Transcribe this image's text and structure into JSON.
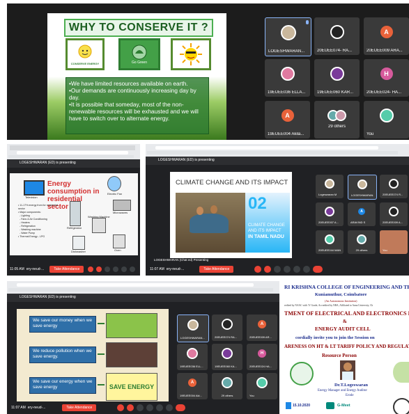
{
  "p1": {
    "slide_title": "WHY TO CONSERVE IT ?",
    "img1_caption": "CONSERVE ENERGY",
    "img2_caption": "Go Green",
    "bullets": [
      "We have limited resources available on earth.",
      "Our demands are continuously increasing day by day.",
      "It is possible that someday, most of the non-renewable resources will be exhausted and we will have to switch over to alternate energy."
    ],
    "participants": [
      {
        "name": "LOGESHWARAN...",
        "type": "photo"
      },
      {
        "name": "20EUEE074- RA...",
        "type": "photo"
      },
      {
        "name": "20EUEE009 ARA...",
        "type": "letter",
        "letter": "A"
      },
      {
        "name": "19EUEE036 ELLA...",
        "type": "photo"
      },
      {
        "name": "19EUEE060 KAR...",
        "type": "photo"
      },
      {
        "name": "20EUEE024- HA...",
        "type": "letter",
        "letter": "H"
      },
      {
        "name": "19EUEE004 Akila...",
        "type": "letter",
        "letter": "A"
      },
      {
        "name": "29 others",
        "type": "group"
      },
      {
        "name": "You",
        "type": "photo"
      }
    ]
  },
  "p2": {
    "presenting": "LOGESHWARAN (ED) is presenting",
    "slide_title": "Energy consumption in residential sector",
    "items": [
      "Television",
      "Electric Fan",
      "Refrigerator",
      "Microwaves",
      "Washing Machine",
      "Dishwasher",
      "Oven",
      "Iron"
    ],
    "bullets": [
      "11-17% energy from for residential sector",
      "Major components:",
      "Lighting",
      "Fans & Air Conditioning",
      "Heaters",
      "Refrigeration",
      "Washing machine",
      "Water Pump",
      "Thermal Energy - LPG"
    ],
    "time": "11:05 AM",
    "meeting": "ery-neud-...",
    "take_attendance": "Take Attendance"
  },
  "p3": {
    "presenting": "LOGESHWARAN (ED) is presenting",
    "slide_title": "CLIMATE CHANGE AND ITS IMPACT",
    "img_caption_line1": "CLIMATE CHANGE",
    "img_caption_line2": "AND ITS IMPACT",
    "img_caption_line3": "IN TAMIL NADU",
    "num": "02",
    "time": "11:07 AM",
    "meeting": "ery-neud-...",
    "take_attendance": "Take Attendance",
    "bottom_name": "LOGESHWARAN (Chat ed) Presenting",
    "participants": [
      "Logeswaran M",
      "LOGESHWARAN...",
      "20EUEE074 R...",
      "20EUEE007 A...",
      "ARAVIND S",
      "20EUEE009 A...",
      "20EUEE044 MAN...",
      "29 others",
      "You"
    ]
  },
  "p4": {
    "presenting": "LOGESHWARAN (ED) is presenting",
    "boxes": [
      "We save our money when we save energy",
      "We reduce pollution when we save energy.",
      "We save our energy when we save energy"
    ],
    "img3_text": "SAVE ENERGY",
    "time": "11:07 AM",
    "meeting": "ery-neud-...",
    "take_attendance": "Take Attendance",
    "participants": [
      "LOGESHWARAN...",
      "20EUEE074 RA...",
      "20EUEE009 AR...",
      "19EUEE036 ELL...",
      "19EUEE060 KA...",
      "20EUEE024 HA...",
      "19EUEE004 Aki...",
      "29 others",
      "You"
    ]
  },
  "p5": {
    "college": "RI KRISHNA COLLEGE OF ENGINEERING AND TECHNOLOGY",
    "location": "Kuniamuthur, Coimbatore",
    "autonomous": "(An Autonomous Institution)",
    "accredited": "redited by NAAC with 'A' Grade, Accredited by NBA, Affiliated to Anna University, Ch",
    "dept": "TMENT OF ELECTRICAL AND ELECTRONICS ENGINEERING",
    "amp": "&",
    "cell": "ENERGY AUDIT CELL",
    "invite": "cordially invite you to join the Session on",
    "topic": "ARENESS ON HT & LT TARIFF POLICY AND REGULATIONS",
    "resource": "Resource Person",
    "speaker": "Dr.T.Logeswaran",
    "role": "Energy Manager and Energy Auditor",
    "city": "Erode",
    "date": "15.10.2020",
    "platform": "G-Meet"
  },
  "colors": {
    "meet_bg": "#202124",
    "tile_bg": "#3c4043",
    "red": "#ea4335",
    "slide_green": "#2e7d32",
    "dark_red": "#8b0000",
    "blue_title": "#1a2b8c"
  }
}
